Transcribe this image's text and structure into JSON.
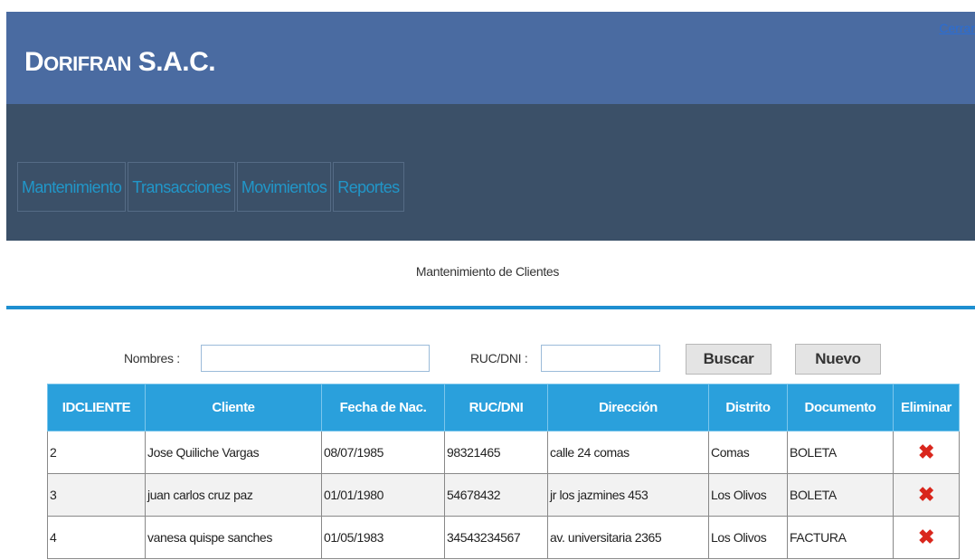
{
  "header": {
    "brand_big": "D",
    "brand_small": "ORIFRAN",
    "brand_rest": " S.A.C.",
    "logout_label": "Cerrar"
  },
  "menu": {
    "items": [
      {
        "label": "Mantenimiento"
      },
      {
        "label": "Transacciones"
      },
      {
        "label": "Movimientos"
      },
      {
        "label": "Reportes"
      }
    ]
  },
  "page_title": "Mantenimiento de Clientes",
  "search": {
    "nombres_label": "Nombres :",
    "nombres_value": "",
    "ruc_label": "RUC/DNI :",
    "ruc_value": "",
    "buscar_label": "Buscar",
    "nuevo_label": "Nuevo"
  },
  "table": {
    "columns": [
      "IDCLIENTE",
      "Cliente",
      "Fecha de Nac.",
      "RUC/DNI",
      "Dirección",
      "Distrito",
      "Documento",
      "Eliminar"
    ],
    "rows": [
      [
        "2",
        "Jose Quiliche Vargas",
        "08/07/1985",
        "98321465",
        "calle 24 comas",
        "Comas",
        "BOLETA"
      ],
      [
        "3",
        "juan carlos cruz paz",
        "01/01/1980",
        "54678432",
        "jr los jazmines 453",
        "Los Olivos",
        "BOLETA"
      ],
      [
        "4",
        "vanesa quispe sanches",
        "01/05/1983",
        "34543234567",
        "av. universitaria 2365",
        "Los Olivos",
        "FACTURA"
      ]
    ],
    "delete_icon": "delete-x-icon"
  },
  "colors": {
    "header_bg": "#4a6ba1",
    "nav_bg": "#3b5068",
    "menu_text": "#2196c8",
    "table_header_bg": "#2aa0dc",
    "divider": "#1e8fd0",
    "delete_icon": "#d9261c"
  }
}
